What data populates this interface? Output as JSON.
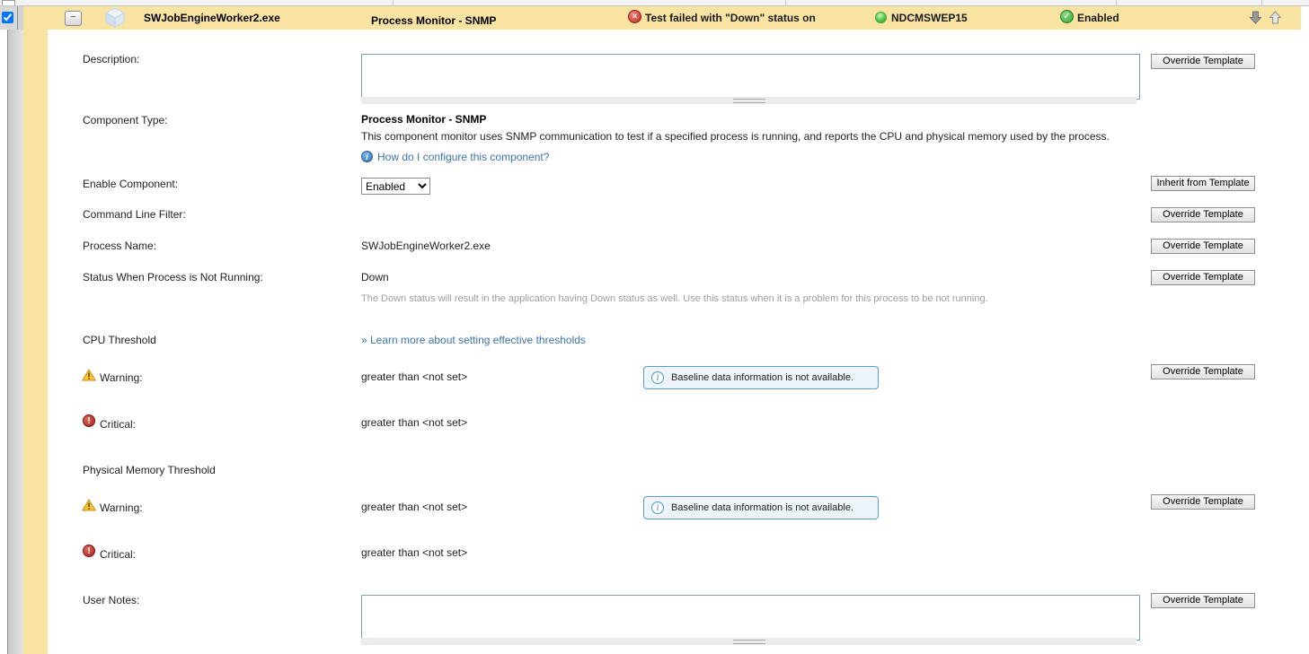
{
  "header": {
    "name": "SWJobEngineWorker2.exe",
    "type": "Process Monitor - SNMP",
    "fail_text": "Test failed with \"Down\" status on",
    "server": "NDCMSWEP15",
    "enabled_label": "Enabled",
    "collapse_glyph": "−"
  },
  "rows": {
    "description": {
      "label": "Description:",
      "value": "",
      "button": "Override Template"
    },
    "component_type": {
      "label": "Component Type:",
      "value": "Process Monitor - SNMP",
      "info": "This component monitor uses SNMP communication to test if a specified process is running, and reports the CPU and physical memory used by the process.",
      "help_link": "How do I configure this component?"
    },
    "enable_component": {
      "label": "Enable Component:",
      "value": "Enabled",
      "button": "Inherit from Template"
    },
    "command_line_filter": {
      "label": "Command Line Filter:",
      "button": "Override Template"
    },
    "process_name": {
      "label": "Process Name:",
      "value": "SWJobEngineWorker2.exe",
      "button": "Override Template"
    },
    "status_not_running": {
      "label": "Status When Process is Not Running:",
      "value": "Down",
      "help": "The Down status will result in the application having Down status as well. Use this status when it is a problem for this process to be not running.",
      "button": "Override Template"
    },
    "cpu_threshold": {
      "label": "CPU Threshold",
      "link": "» Learn more about setting effective thresholds"
    },
    "cpu_warning": {
      "label": "Warning:",
      "value": "greater than <not set>",
      "baseline": "Baseline data information is not available.",
      "button": "Override Template"
    },
    "cpu_critical": {
      "label": "Critical:",
      "value": "greater than <not set>"
    },
    "memory_threshold": {
      "label": "Physical Memory Threshold"
    },
    "memory_warning": {
      "label": "Warning:",
      "value": "greater than <not set>",
      "baseline": "Baseline data information is not available.",
      "button": "Override Template"
    },
    "memory_critical": {
      "label": "Critical:",
      "value": "greater than <not set>"
    },
    "user_notes": {
      "label": "User Notes:",
      "value": "",
      "button": "Override Template"
    }
  },
  "colors": {
    "header_yellow": "#F8E3A3",
    "status_fail_red": "#C03028",
    "status_up_green": "#45C43A",
    "enabled_green": "#33A433",
    "link_blue": "#3F74AD",
    "baseline_border_blue": "#5B9BC8",
    "warning_yellow": "#FBC330",
    "critical_red": "#A81F1F"
  }
}
